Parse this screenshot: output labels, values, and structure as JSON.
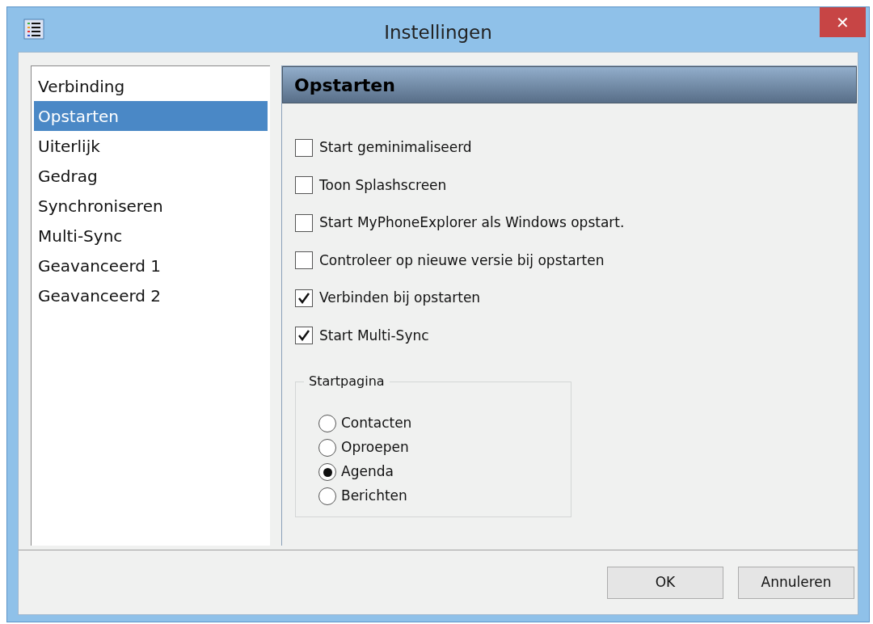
{
  "window": {
    "title": "Instellingen",
    "close": "✕"
  },
  "sidebar": {
    "items": [
      {
        "label": "Verbinding",
        "selected": false
      },
      {
        "label": "Opstarten",
        "selected": true
      },
      {
        "label": "Uiterlijk",
        "selected": false
      },
      {
        "label": "Gedrag",
        "selected": false
      },
      {
        "label": "Synchroniseren",
        "selected": false
      },
      {
        "label": "Multi-Sync",
        "selected": false
      },
      {
        "label": "Geavanceerd 1",
        "selected": false
      },
      {
        "label": "Geavanceerd 2",
        "selected": false
      }
    ]
  },
  "panel": {
    "title": "Opstarten",
    "options": [
      {
        "label": "Start geminimaliseerd",
        "checked": false
      },
      {
        "label": "Toon Splashscreen",
        "checked": false
      },
      {
        "label": "Start MyPhoneExplorer als Windows opstart.",
        "checked": false
      },
      {
        "label": "Controleer op nieuwe versie bij opstarten",
        "checked": false
      },
      {
        "label": "Verbinden bij opstarten",
        "checked": true
      },
      {
        "label": "Start Multi-Sync",
        "checked": true
      }
    ],
    "startpage": {
      "title": "Startpagina",
      "options": [
        {
          "label": "Contacten",
          "selected": false
        },
        {
          "label": "Oproepen",
          "selected": false
        },
        {
          "label": "Agenda",
          "selected": true
        },
        {
          "label": "Berichten",
          "selected": false
        }
      ]
    }
  },
  "buttons": [
    {
      "label": "OK"
    },
    {
      "label": "Annuleren"
    }
  ]
}
